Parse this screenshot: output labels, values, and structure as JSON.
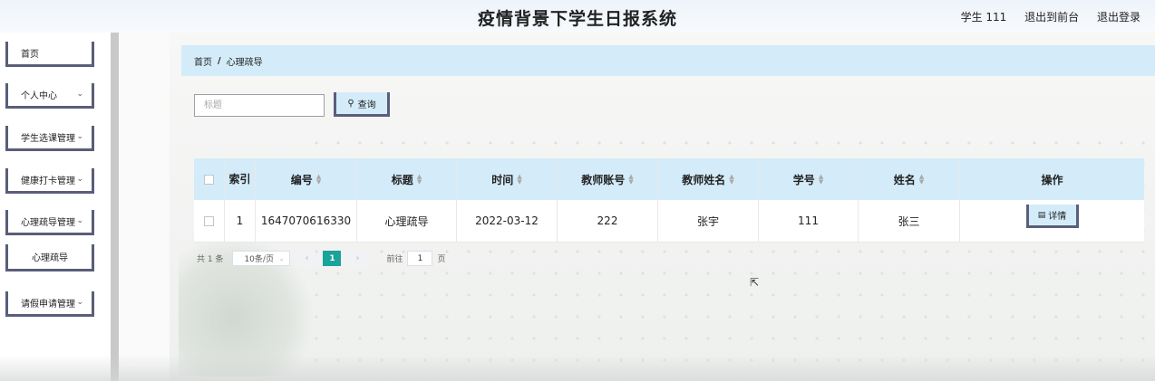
{
  "header": {
    "title": "疫情背景下学生日报系统",
    "user": "学生 111",
    "back_front": "退出到前台",
    "logout": "退出登录"
  },
  "sidebar": {
    "items": [
      {
        "label": "首页"
      },
      {
        "label": "个人中心"
      },
      {
        "label": "学生选课管理"
      },
      {
        "label": "健康打卡管理"
      },
      {
        "label": "心理疏导管理"
      },
      {
        "label": "心理疏导"
      },
      {
        "label": "请假申请管理"
      }
    ]
  },
  "breadcrumb": {
    "home": "首页",
    "sep": "/",
    "current": "心理疏导"
  },
  "search": {
    "placeholder": "标题",
    "button": "查询"
  },
  "table": {
    "headers": [
      "索引",
      "编号",
      "标题",
      "时间",
      "教师账号",
      "教师姓名",
      "学号",
      "姓名",
      "操作"
    ],
    "rows": [
      [
        "1",
        "1647070616330",
        "心理疏导",
        "2022-03-12",
        "222",
        "张宇",
        "111",
        "张三",
        "详情"
      ]
    ]
  },
  "pagination": {
    "total": "共 1 条",
    "page_size": "10条/页",
    "current_page": "1",
    "goto_label": "前往",
    "goto_value": "1",
    "page_unit": "页"
  },
  "colors": {
    "accent": "#d4ecfa",
    "active_page": "#1aa39a",
    "border_dark": "#5a5e7a"
  }
}
